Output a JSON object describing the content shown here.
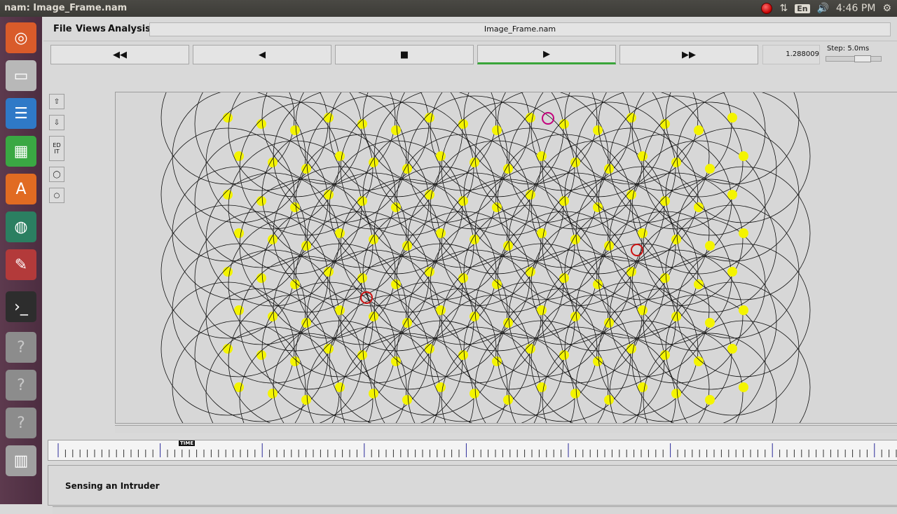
{
  "window": {
    "title": "nam: Image_Frame.nam"
  },
  "system_tray": {
    "language": "En",
    "time": "4:46 PM"
  },
  "menu": {
    "file": "File",
    "views": "Views",
    "analysis": "Analysis",
    "file_title": "Image_Frame.nam"
  },
  "controls": {
    "rewind_icon": "◀◀",
    "back_icon": "◀",
    "stop_icon": "■",
    "play_icon": "▶",
    "fast_forward_icon": "▶▶",
    "current_time": "1.288009",
    "step_label": "Step: 5.0ms"
  },
  "tools": {
    "edit_label": "ED\nIT"
  },
  "timeline": {
    "marker": "TIME"
  },
  "annotation": {
    "text": "Sensing an Intruder"
  }
}
